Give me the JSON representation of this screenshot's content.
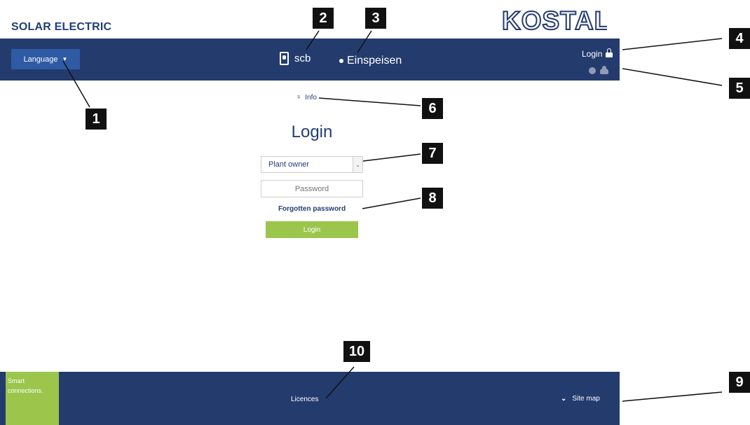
{
  "brand": {
    "tagline": "SOLAR ELECTRIC",
    "logo_text": "KOSTAL"
  },
  "header": {
    "language_label": "Language",
    "device_name": "scb",
    "status_text": "Einspeisen",
    "login_label": "Login"
  },
  "main": {
    "info_label": "Info",
    "title": "Login",
    "user_type_selected": "Plant owner",
    "password_placeholder": "Password",
    "forgot_label": "Forgotten password",
    "login_button_label": "Login"
  },
  "footer": {
    "slogan_line1": "Smart",
    "slogan_line2": "connections.",
    "licences_label": "Licences",
    "sitemap_label": "Site map"
  },
  "callouts": [
    "1",
    "2",
    "3",
    "4",
    "5",
    "6",
    "7",
    "8",
    "9",
    "10"
  ],
  "colors": {
    "navy": "#243b6e",
    "accent_green": "#9bc64b",
    "language_blue": "#2f5aa4"
  }
}
